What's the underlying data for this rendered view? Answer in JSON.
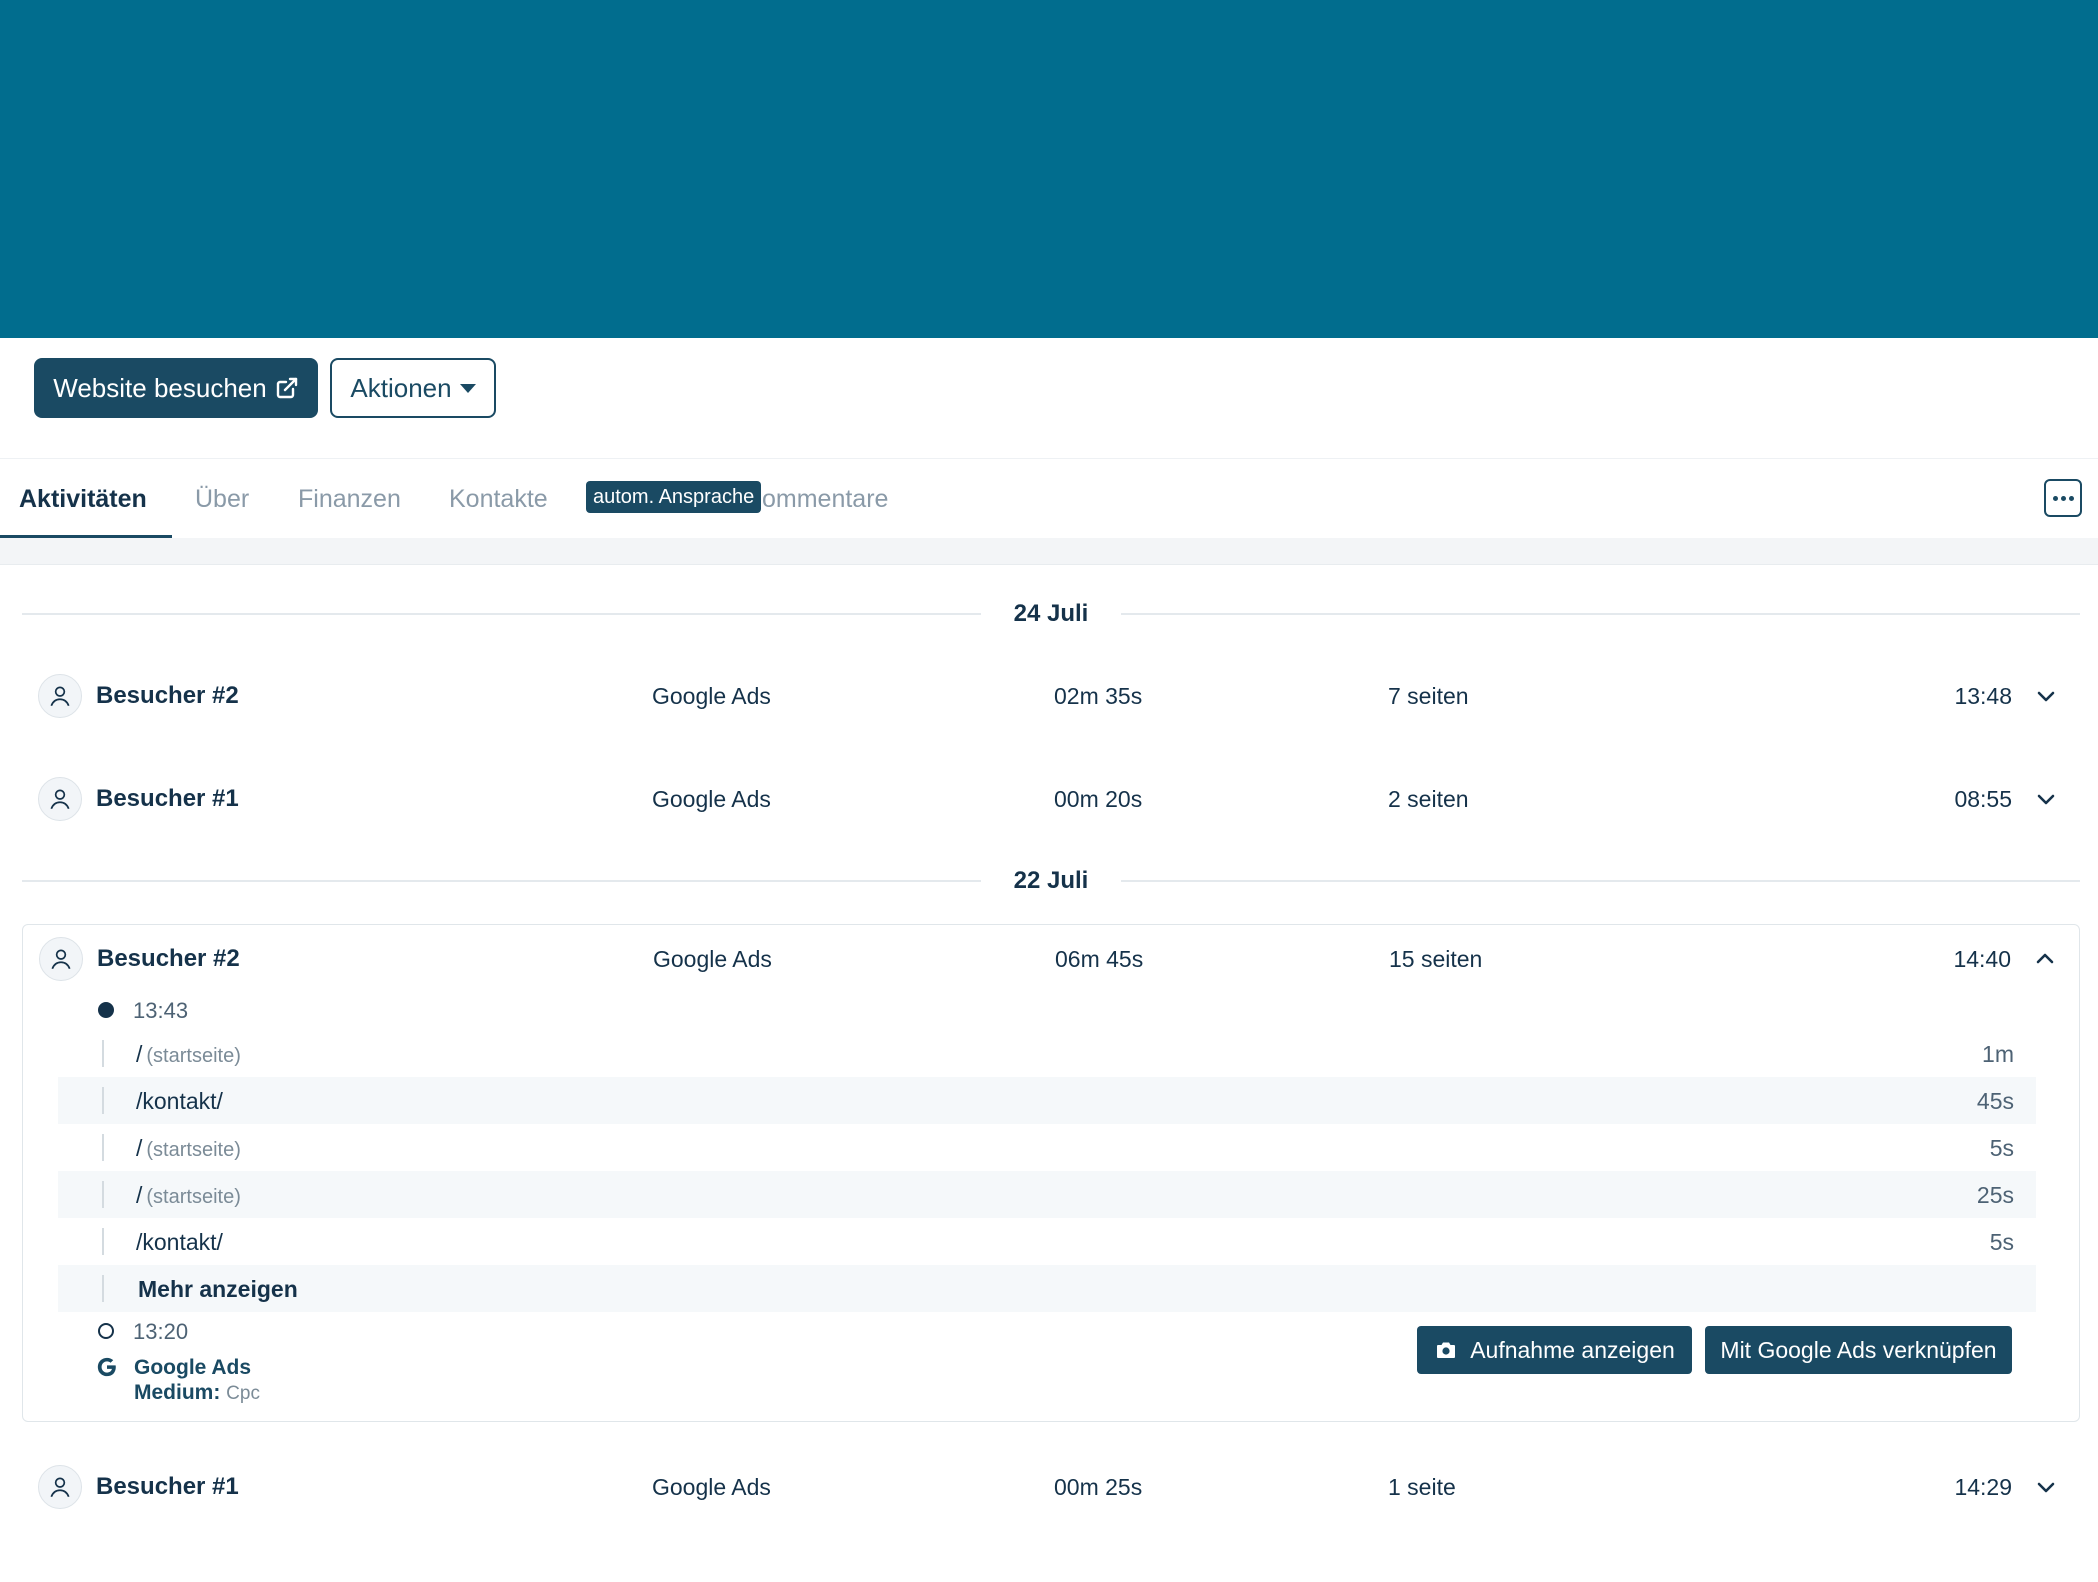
{
  "toolbar": {
    "visit_label": "Website besuchen",
    "actions_label": "Aktionen"
  },
  "tabs": [
    {
      "label": "Aktivitäten",
      "active": true
    },
    {
      "label": "Über"
    },
    {
      "label": "Finanzen"
    },
    {
      "label": "Kontakte"
    },
    {
      "label": "ommentare"
    }
  ],
  "tooltip": "autom. Ansprache",
  "days": [
    {
      "date": "24 Juli",
      "visits": [
        {
          "name": "Besucher #2",
          "source": "Google Ads",
          "duration": "02m 35s",
          "pages": "7 seiten",
          "time": "13:48"
        },
        {
          "name": "Besucher #1",
          "source": "Google Ads",
          "duration": "00m 20s",
          "pages": "2 seiten",
          "time": "08:55"
        }
      ]
    },
    {
      "date": "22 Juli",
      "visits": [
        {
          "name": "Besucher #2",
          "source": "Google Ads",
          "duration": "06m 45s",
          "pages": "15 seiten",
          "time": "14:40",
          "expanded": true,
          "timeline_start": "13:43",
          "page_views": [
            {
              "path": "/",
              "hint": "(startseite)",
              "duration": "1m"
            },
            {
              "path": "/kontakt/",
              "hint": "",
              "duration": "45s"
            },
            {
              "path": "/",
              "hint": "(startseite)",
              "duration": "5s"
            },
            {
              "path": "/",
              "hint": "(startseite)",
              "duration": "25s"
            },
            {
              "path": "/kontakt/",
              "hint": "",
              "duration": "5s"
            }
          ],
          "show_more_label": "Mehr anzeigen",
          "timeline_end": "13:20",
          "traffic_source": {
            "name": "Google Ads",
            "medium_label": "Medium:",
            "medium_value": "Cpc"
          },
          "record_button": "Aufnahme anzeigen",
          "link_button": "Mit Google Ads verknüpfen"
        },
        {
          "name": "Besucher #1",
          "source": "Google Ads",
          "duration": "00m 25s",
          "pages": "1 seite",
          "time": "14:29"
        }
      ]
    }
  ],
  "colors": {
    "banner": "#016d8e",
    "primary": "#1a4a63"
  }
}
